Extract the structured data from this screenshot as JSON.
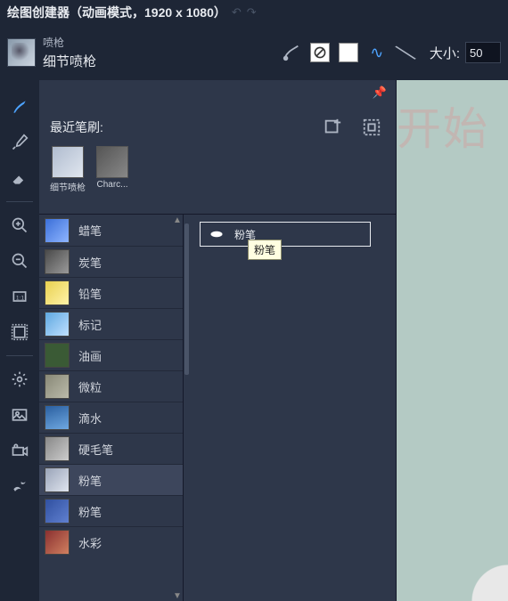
{
  "title": "绘图创建器（动画模式，1920 x 1080）",
  "header": {
    "brush_type": "喷枪",
    "brush_name": "细节喷枪",
    "size_label": "大小:",
    "size_value": "50"
  },
  "canvas": {
    "watermark": "开始"
  },
  "panel": {
    "pin_icon": "pin-icon",
    "recent_label": "最近笔刷:",
    "recent": [
      {
        "name": "细节喷枪",
        "thumb": "light"
      },
      {
        "name": "Charc...",
        "thumb": "dark"
      }
    ],
    "categories": [
      {
        "label": "蜡笔",
        "thumb": "t-blue"
      },
      {
        "label": "炭笔",
        "thumb": "t-gray"
      },
      {
        "label": "铅笔",
        "thumb": "t-yel"
      },
      {
        "label": "标记",
        "thumb": "t-mark"
      },
      {
        "label": "油画",
        "thumb": "t-oil"
      },
      {
        "label": "微粒",
        "thumb": "t-part"
      },
      {
        "label": "滴水",
        "thumb": "t-drop"
      },
      {
        "label": "硬毛笔",
        "thumb": "t-hard"
      },
      {
        "label": "粉笔",
        "thumb": "t-chalk",
        "selected": true
      },
      {
        "label": "粉笔",
        "thumb": "t-chalk2"
      },
      {
        "label": "水彩",
        "thumb": "t-water"
      }
    ],
    "sub_items": [
      {
        "label": "粉笔"
      }
    ],
    "tooltip": "粉笔"
  },
  "left_tools": [
    "brush",
    "eyedropper",
    "eraser",
    "zoom-in",
    "zoom-out",
    "actual-size",
    "fit-screen",
    "settings",
    "image",
    "camera",
    "effects"
  ]
}
